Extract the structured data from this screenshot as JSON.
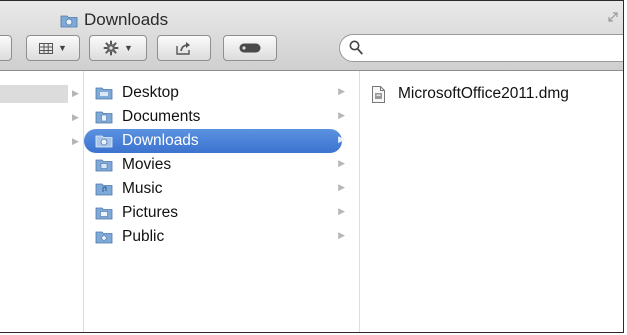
{
  "window": {
    "title": "Downloads"
  },
  "toolbar": {
    "search_placeholder": ""
  },
  "columns": {
    "folders": [
      {
        "label": "Desktop",
        "icon": "desktop-folder-icon",
        "selected": false
      },
      {
        "label": "Documents",
        "icon": "documents-folder-icon",
        "selected": false
      },
      {
        "label": "Downloads",
        "icon": "downloads-folder-icon",
        "selected": true
      },
      {
        "label": "Movies",
        "icon": "movies-folder-icon",
        "selected": false
      },
      {
        "label": "Music",
        "icon": "music-folder-icon",
        "selected": false
      },
      {
        "label": "Pictures",
        "icon": "pictures-folder-icon",
        "selected": false
      },
      {
        "label": "Public",
        "icon": "public-folder-icon",
        "selected": false
      }
    ],
    "files": [
      {
        "label": "MicrosoftOffice2011.dmg",
        "icon": "disk-image-file-icon"
      }
    ]
  },
  "colors": {
    "selection": "#3b73cf",
    "folder": "#7fa9d6"
  }
}
